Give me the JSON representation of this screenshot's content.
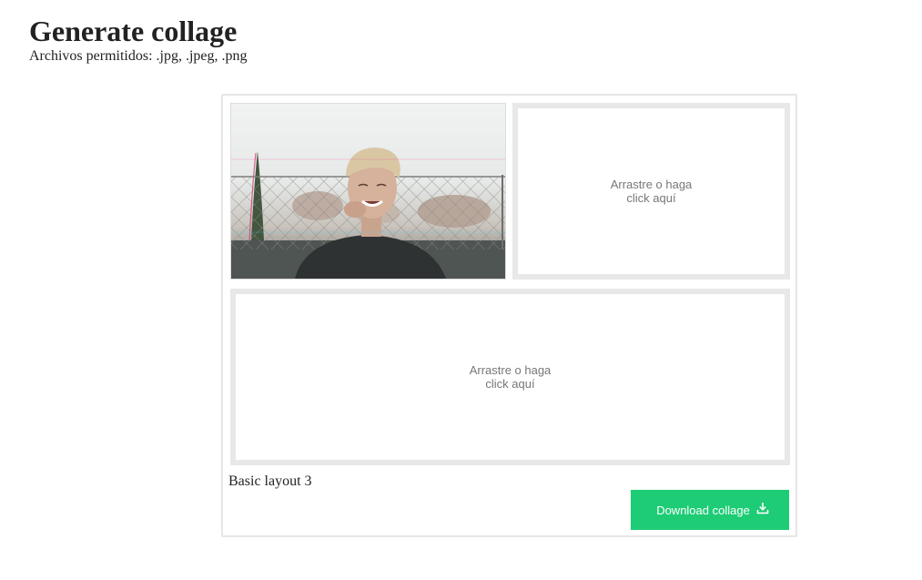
{
  "header": {
    "title": "Generate collage",
    "allowed_files": "Archivos permitidos: .jpg, .jpeg, .png"
  },
  "collage": {
    "slots": [
      {
        "type": "image",
        "content": "photo of a smiling young man with blond hair in front of a chain-link fence"
      },
      {
        "type": "empty",
        "placeholder_line1": "Arrastre o haga",
        "placeholder_line2": "click aquí"
      },
      {
        "type": "empty",
        "placeholder_line1": "Arrastre o haga",
        "placeholder_line2": "click aquí"
      }
    ],
    "layout_name": "Basic layout 3"
  },
  "actions": {
    "download_label": "Download collage",
    "download_icon": "download-icon",
    "download_color": "#1dcc75"
  },
  "colors": {
    "slot_border": "#e8e8e8",
    "card_border": "#e6e6e6",
    "placeholder_text": "#777777",
    "heading_text": "#222222"
  }
}
